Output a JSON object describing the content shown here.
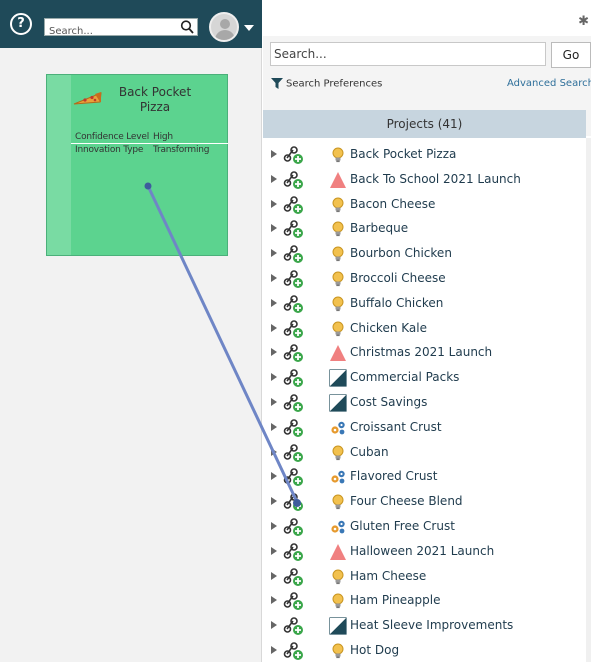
{
  "header": {
    "help_icon": "help-icon",
    "search_placeholder": "Search...",
    "avatar_icon": "user-avatar-icon"
  },
  "card": {
    "title": "Back Pocket Pizza",
    "attributes": [
      {
        "label": "Confidence Level",
        "value": "High"
      },
      {
        "label": "Innovation Type",
        "value": "Transforming"
      }
    ],
    "color": "#5cd38f"
  },
  "panel": {
    "search_placeholder": "Search...",
    "go_label": "Go",
    "prefs_label": "Search Preferences",
    "advanced_label": "Advanced Search",
    "projects_header": "Projects (41)"
  },
  "projects": [
    {
      "name": "Back Pocket Pizza",
      "icon": "lightbulb"
    },
    {
      "name": "Back To School 2021 Launch",
      "icon": "triangle"
    },
    {
      "name": "Bacon Cheese",
      "icon": "lightbulb"
    },
    {
      "name": "Barbeque",
      "icon": "lightbulb"
    },
    {
      "name": "Bourbon Chicken",
      "icon": "lightbulb"
    },
    {
      "name": "Broccoli Cheese",
      "icon": "lightbulb"
    },
    {
      "name": "Buffalo Chicken",
      "icon": "lightbulb"
    },
    {
      "name": "Chicken Kale",
      "icon": "lightbulb"
    },
    {
      "name": "Christmas 2021 Launch",
      "icon": "triangle"
    },
    {
      "name": "Commercial Packs",
      "icon": "split-square"
    },
    {
      "name": "Cost Savings",
      "icon": "split-square"
    },
    {
      "name": "Croissant Crust",
      "icon": "gears"
    },
    {
      "name": "Cuban",
      "icon": "lightbulb"
    },
    {
      "name": "Flavored Crust",
      "icon": "gears"
    },
    {
      "name": "Four Cheese Blend",
      "icon": "lightbulb"
    },
    {
      "name": "Gluten Free Crust",
      "icon": "gears"
    },
    {
      "name": "Halloween 2021 Launch",
      "icon": "triangle"
    },
    {
      "name": "Ham Cheese",
      "icon": "lightbulb"
    },
    {
      "name": "Ham Pineapple",
      "icon": "lightbulb"
    },
    {
      "name": "Heat Sleeve Improvements",
      "icon": "split-square"
    },
    {
      "name": "Hot Dog",
      "icon": "lightbulb"
    }
  ],
  "colors": {
    "topbar": "#1f4a59",
    "connector": "#6f86c6",
    "triangle": "#f08080",
    "lightbulb": "#f2c14e",
    "link_plus": "#3aa64a"
  }
}
